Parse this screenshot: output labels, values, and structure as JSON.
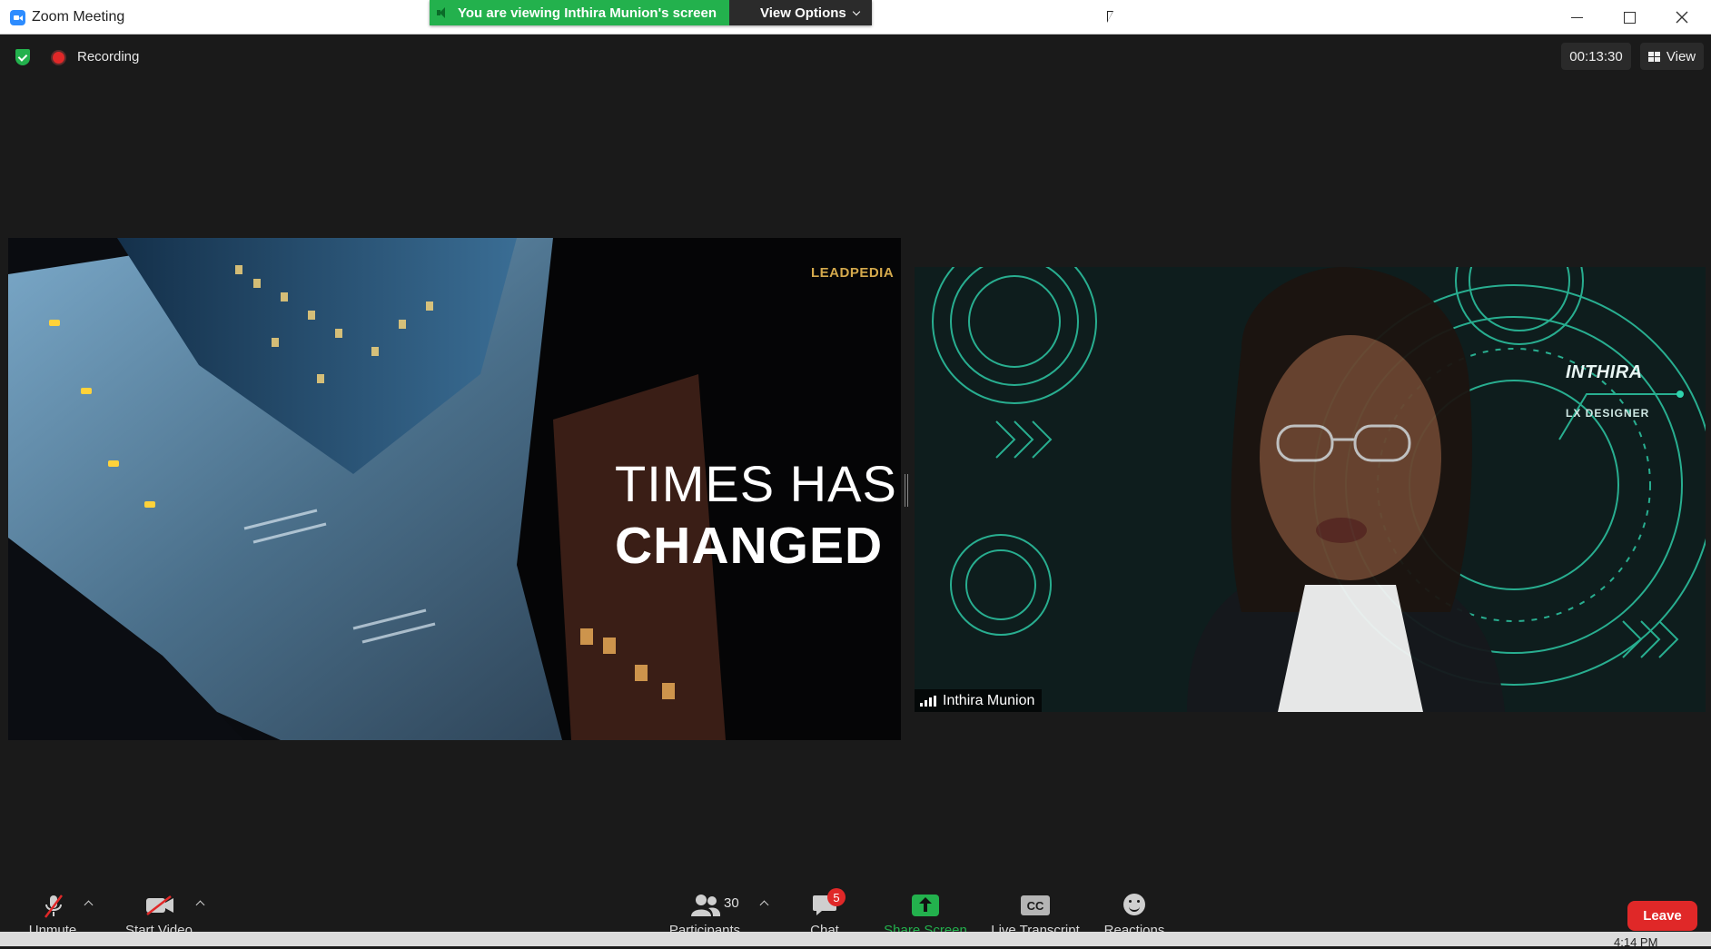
{
  "window": {
    "title": "Zoom Meeting",
    "controls": {
      "minimize": "minimize",
      "maximize": "maximize",
      "close": "close"
    }
  },
  "banner": {
    "viewing_text": "You are viewing Inthira Munion's screen",
    "view_options_label": "View Options"
  },
  "status": {
    "recording_label": "Recording",
    "timer": "00:13:30",
    "view_label": "View"
  },
  "shared_screen": {
    "logo_text": "LEADPEDIA",
    "headline_line1": "TIMES HAS",
    "headline_line2": "CHANGED"
  },
  "speaker_video": {
    "participant_name": "Inthira Munion",
    "overlay_name": "INTHIRA",
    "overlay_role": "LX DESIGNER"
  },
  "toolbar": {
    "unmute_label": "Unmute",
    "start_video_label": "Start Video",
    "participants_count": "30",
    "participants_label": "Participants",
    "chat_label": "Chat",
    "chat_badge": "5",
    "share_screen_label": "Share Screen",
    "live_transcript_label": "Live Transcript",
    "cc_icon_text": "CC",
    "reactions_label": "Reactions",
    "leave_label": "Leave"
  },
  "taskbar": {
    "time": "4:14 PM"
  },
  "colors": {
    "accent_green": "#23b14d",
    "leave_red": "#e02828",
    "background": "#1a1a1a"
  }
}
